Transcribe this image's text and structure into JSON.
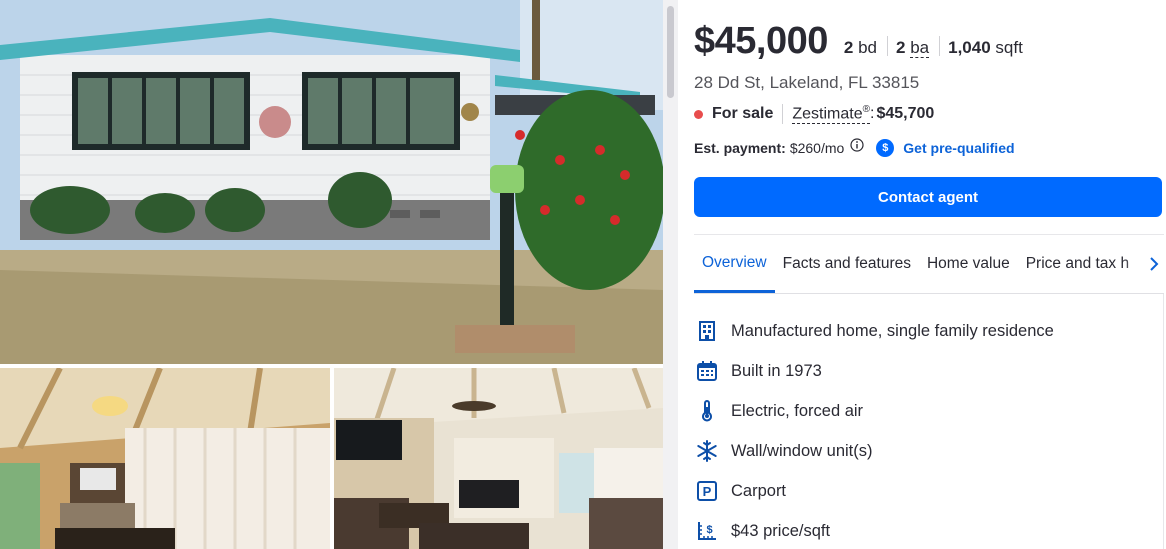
{
  "listing": {
    "price": "$45,000",
    "beds_value": "2",
    "beds_unit": "bd",
    "baths_value": "2",
    "baths_unit": "ba",
    "sqft_value": "1,040",
    "sqft_unit": "sqft",
    "address": "28 Dd St, Lakeland, FL 33815",
    "status": "For sale",
    "zestimate_label": "Zestimate",
    "zestimate_mark": "®",
    "zestimate_value": "$45,700",
    "payment_label": "Est. payment:",
    "payment_value": "$260/mo",
    "prequal_icon_text": "$",
    "prequal_link": "Get pre-qualified",
    "contact_button": "Contact agent"
  },
  "tabs": [
    {
      "label": "Overview",
      "active": true
    },
    {
      "label": "Facts and features",
      "active": false
    },
    {
      "label": "Home value",
      "active": false
    },
    {
      "label": "Price and tax h",
      "active": false
    }
  ],
  "facts": [
    {
      "icon": "building-icon",
      "text": "Manufactured home, single family residence"
    },
    {
      "icon": "calendar-icon",
      "text": "Built in 1973"
    },
    {
      "icon": "thermometer-icon",
      "text": "Electric, forced air"
    },
    {
      "icon": "snowflake-icon",
      "text": "Wall/window unit(s)"
    },
    {
      "icon": "parking-icon",
      "text": "Carport",
      "icon_text": "P"
    },
    {
      "icon": "price-per-sqft-icon",
      "text": "$43 price/sqft"
    }
  ],
  "colors": {
    "accent": "#006aff",
    "link": "#0d63d8",
    "status_dot": "#e84d4d",
    "text": "#2a2a33"
  }
}
